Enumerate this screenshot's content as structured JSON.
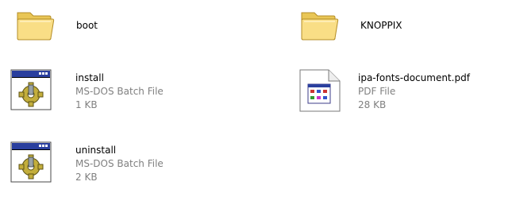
{
  "items": [
    {
      "name": "boot",
      "kind": "folder",
      "icon": "folder-icon"
    },
    {
      "name": "KNOPPIX",
      "kind": "folder",
      "icon": "folder-icon"
    },
    {
      "name": "install",
      "type": "MS-DOS Batch File",
      "size": "1 KB",
      "icon": "batch-file-icon"
    },
    {
      "name": "ipa-fonts-document.pdf",
      "type": "PDF File",
      "size": "28 KB",
      "icon": "pdf-file-icon"
    },
    {
      "name": "uninstall",
      "type": "MS-DOS Batch File",
      "size": "2 KB",
      "icon": "batch-file-icon"
    }
  ],
  "colors": {
    "folder_fill": "#f7d978",
    "folder_edge": "#c9a23a",
    "batch_titlebar": "#2a3f9e",
    "gear": "#b6a233",
    "secondary_text": "#808080"
  }
}
